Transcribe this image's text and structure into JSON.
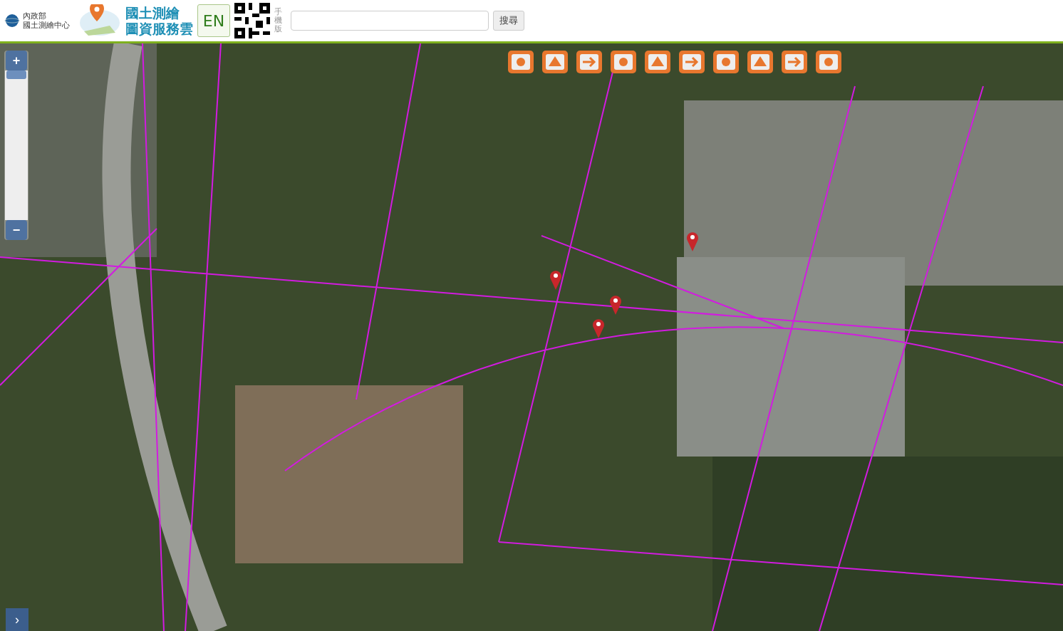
{
  "header": {
    "agency_lines": [
      "內政部",
      "國土測繪中心"
    ],
    "app_title_lines": [
      "國土測繪",
      "圖資服務雲"
    ],
    "language_button": "EN",
    "mobile_label": "手機版",
    "search_button": "搜尋"
  },
  "zoom": {
    "plus": "+",
    "minus": "−",
    "level": 1
  },
  "panel_toggle": "›"
}
